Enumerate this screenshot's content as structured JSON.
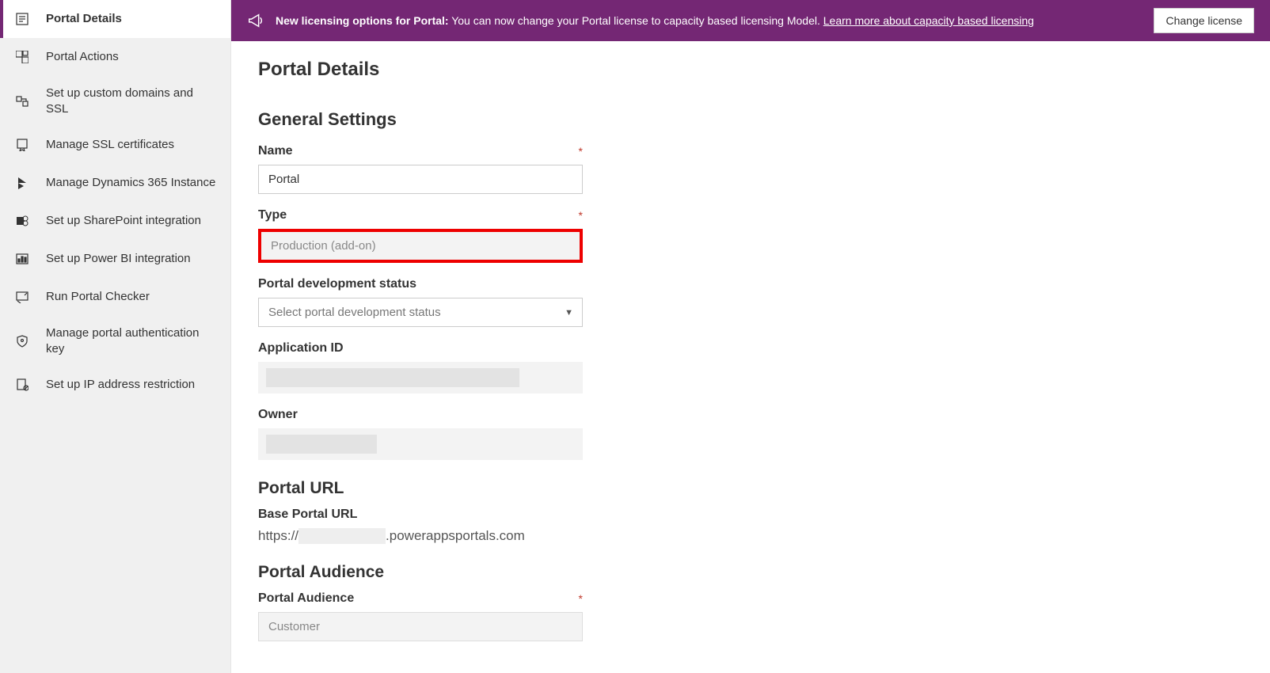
{
  "banner": {
    "bold": "New licensing options for Portal:",
    "text": " You can now change your Portal license to capacity based licensing Model. ",
    "link": "Learn more about capacity based licensing",
    "button": "Change license"
  },
  "sidebar": {
    "items": [
      {
        "label": "Portal Details"
      },
      {
        "label": "Portal Actions"
      },
      {
        "label": "Set up custom domains and SSL"
      },
      {
        "label": "Manage SSL certificates"
      },
      {
        "label": "Manage Dynamics 365 Instance"
      },
      {
        "label": "Set up SharePoint integration"
      },
      {
        "label": "Set up Power BI integration"
      },
      {
        "label": "Run Portal Checker"
      },
      {
        "label": "Manage portal authentication key"
      },
      {
        "label": "Set up IP address restriction"
      }
    ]
  },
  "page": {
    "title": "Portal Details",
    "general": {
      "heading": "General Settings",
      "name_label": "Name",
      "name_value": "Portal",
      "type_label": "Type",
      "type_value": "Production (add-on)",
      "status_label": "Portal development status",
      "status_placeholder": "Select portal development status",
      "appid_label": "Application ID",
      "owner_label": "Owner"
    },
    "url": {
      "heading": "Portal URL",
      "base_label": "Base Portal URL",
      "prefix": "https://",
      "suffix": ".powerappsportals.com"
    },
    "audience": {
      "heading": "Portal Audience",
      "label": "Portal Audience",
      "value": "Customer"
    }
  }
}
